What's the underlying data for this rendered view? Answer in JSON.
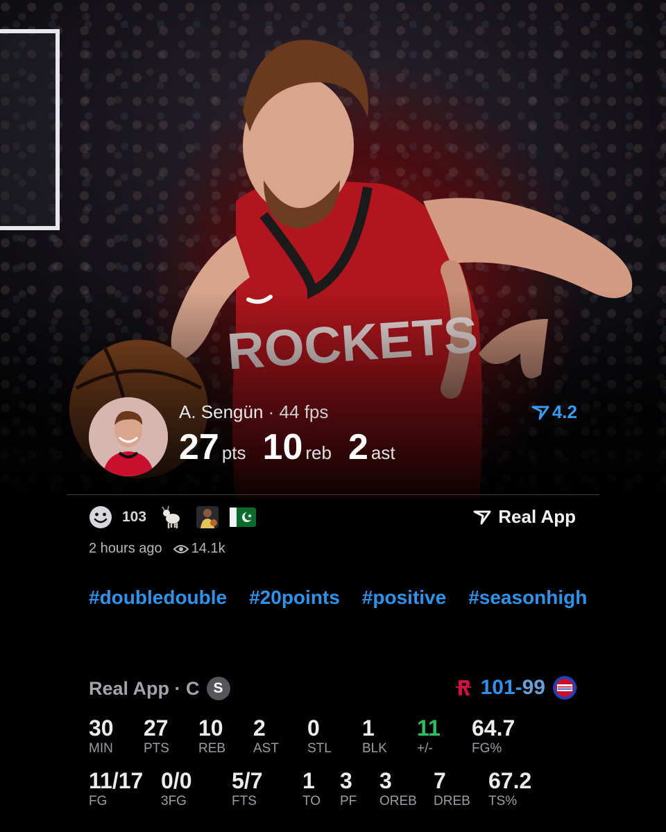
{
  "player": {
    "name": "A. Sengün",
    "fps_text": "· 44 fps",
    "rating": "4.2",
    "stats": [
      {
        "value": "27",
        "unit": "pts"
      },
      {
        "value": "10",
        "unit": "reb"
      },
      {
        "value": "2",
        "unit": "ast"
      }
    ]
  },
  "reactions": {
    "count": "103"
  },
  "brand": {
    "label": "Real App"
  },
  "meta": {
    "time": "2 hours ago",
    "views": "14.1k"
  },
  "tags": [
    "#doubledouble",
    "#20points",
    "#positive",
    "#seasonhigh"
  ],
  "boxscore": {
    "header": "Real App · C",
    "badge": "S",
    "score_home": "101",
    "score_sep": "-",
    "score_away": "99",
    "row1": [
      {
        "value": "30",
        "label": "MIN"
      },
      {
        "value": "27",
        "label": "PTS"
      },
      {
        "value": "10",
        "label": "REB"
      },
      {
        "value": "2",
        "label": "AST"
      },
      {
        "value": "0",
        "label": "STL"
      },
      {
        "value": "1",
        "label": "BLK"
      },
      {
        "value": "11",
        "label": "+/-"
      },
      {
        "value": "64.7",
        "label": "FG%"
      }
    ],
    "row2": [
      {
        "value": "11/17",
        "label": "FG"
      },
      {
        "value": "0/0",
        "label": "3FG"
      },
      {
        "value": "5/7",
        "label": "FTS"
      },
      {
        "value": "1",
        "label": "TO"
      },
      {
        "value": "3",
        "label": "PF"
      },
      {
        "value": "3",
        "label": "OREB"
      },
      {
        "value": "7",
        "label": "DREB"
      },
      {
        "value": "67.2",
        "label": "TS%"
      }
    ]
  },
  "colors": {
    "accent_blue": "#2f93ec",
    "positive_green": "#2fbe62",
    "rockets_red": "#ce1141"
  }
}
